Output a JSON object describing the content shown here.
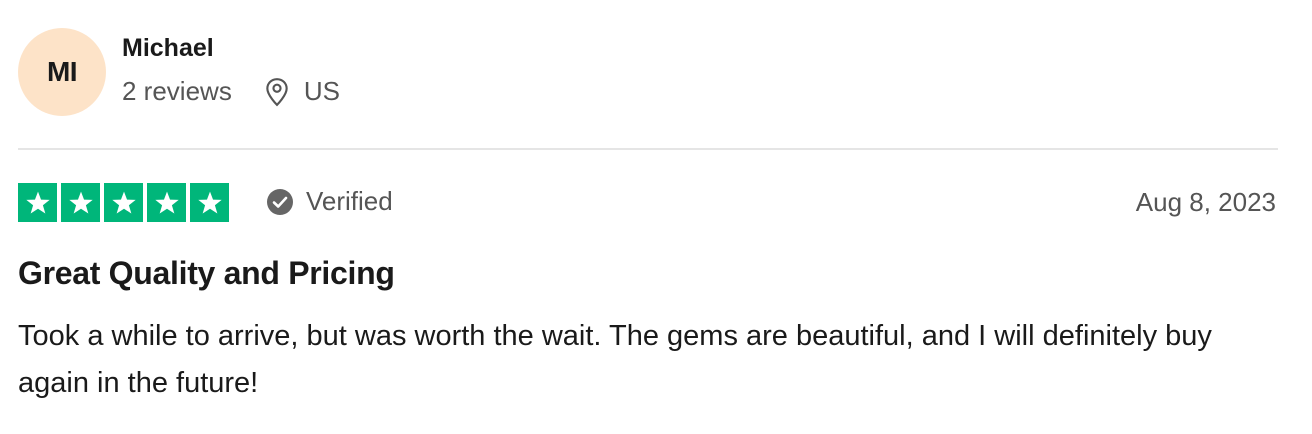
{
  "reviewer": {
    "initials": "MI",
    "name": "Michael",
    "reviews_count": "2 reviews",
    "location": "US",
    "avatar_color": "#fde3c8"
  },
  "review": {
    "rating": 5,
    "max_rating": 5,
    "star_color": "#00b67a",
    "verified_label": "Verified",
    "date": "Aug 8, 2023",
    "title": "Great Quality and Pricing",
    "body": "Took a while to arrive, but was worth the wait. The gems are beautiful, and I will definitely buy again in the future!"
  },
  "icons": {
    "location": "location-pin-icon",
    "verified": "check-circle-icon",
    "star": "star-icon"
  }
}
